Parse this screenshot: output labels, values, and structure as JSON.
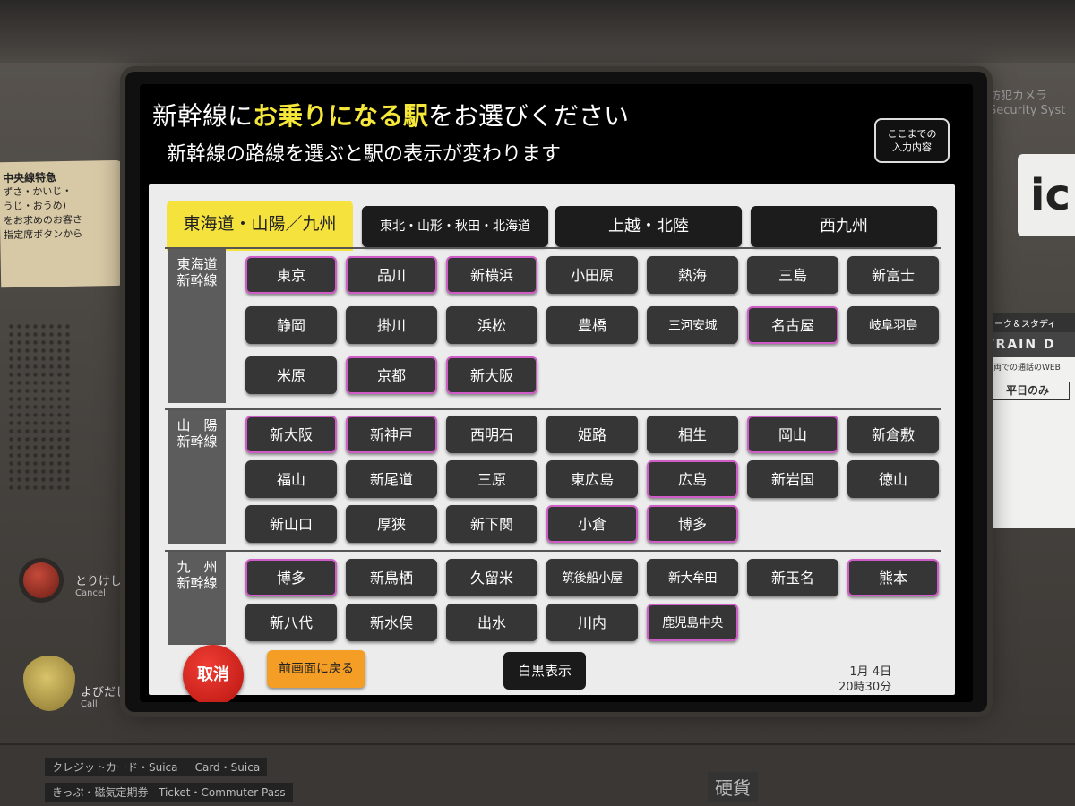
{
  "screen": {
    "title_prefix": "新幹線に",
    "title_highlight": "お乗りになる駅",
    "title_suffix": "をお選びください",
    "subtitle": "新幹線の路線を選ぶと駅の表示が変わります",
    "summary_line1": "ここまでの",
    "summary_line2": "入力内容"
  },
  "tabs": [
    {
      "label": "東海道・山陽／九州",
      "active": true
    },
    {
      "label": "東北・山形・秋田・北海道",
      "active": false
    },
    {
      "label": "上越・北陸",
      "active": false
    },
    {
      "label": "西九州",
      "active": false
    }
  ],
  "sections": {
    "tokaido": {
      "label_line1": "東海道",
      "label_line2": "新幹線",
      "stations": [
        "東京",
        "品川",
        "新横浜",
        "小田原",
        "熱海",
        "三島",
        "新富士",
        "静岡",
        "掛川",
        "浜松",
        "豊橋",
        "三河安城",
        "名古屋",
        "岐阜羽島",
        "米原",
        "京都",
        "新大阪"
      ]
    },
    "sanyo": {
      "label_line1": "山　陽",
      "label_line2": "新幹線",
      "stations": [
        "新大阪",
        "新神戸",
        "西明石",
        "姫路",
        "相生",
        "岡山",
        "新倉敷",
        "福山",
        "新尾道",
        "三原",
        "東広島",
        "広島",
        "新岩国",
        "徳山",
        "新山口",
        "厚狭",
        "新下関",
        "小倉",
        "博多"
      ]
    },
    "kyushu": {
      "label_line1": "九　州",
      "label_line2": "新幹線",
      "stations": [
        "博多",
        "新鳥栖",
        "久留米",
        "筑後船小屋",
        "新大牟田",
        "新玉名",
        "熊本",
        "新八代",
        "新水俣",
        "出水",
        "川内",
        "鹿児島中央"
      ]
    }
  },
  "footer": {
    "cancel": "取消",
    "back": "前画面に戻る",
    "monochrome": "白黒表示",
    "date": "1月 4日",
    "time": "20時30分"
  },
  "machine": {
    "cancel_label": "とりけし",
    "cancel_label_en": "Cancel",
    "call_label": "よびだし",
    "call_label_en": "Call",
    "camera_label": "防犯カメラ",
    "camera_label_en": "Security Syst",
    "ic_mark": "ic",
    "left_notice": [
      "中央線特急",
      "ずさ・かいじ・",
      "うじ・おうめ)",
      "をお求めのお客さ",
      "指定席ボタンから"
    ],
    "right_notice_top": "ワーク＆スタディ",
    "right_notice_title": "TRAIN D",
    "right_notice_body": "車両での通話のWEB",
    "right_notice_box": "平日のみ",
    "card_label": "クレジットカード・Suica",
    "card_label_en": "Card・Suica",
    "ticket_label": "きっぷ・磁気定期券",
    "ticket_label_en": "Ticket・Commuter Pass",
    "coin_label": "硬貨"
  }
}
